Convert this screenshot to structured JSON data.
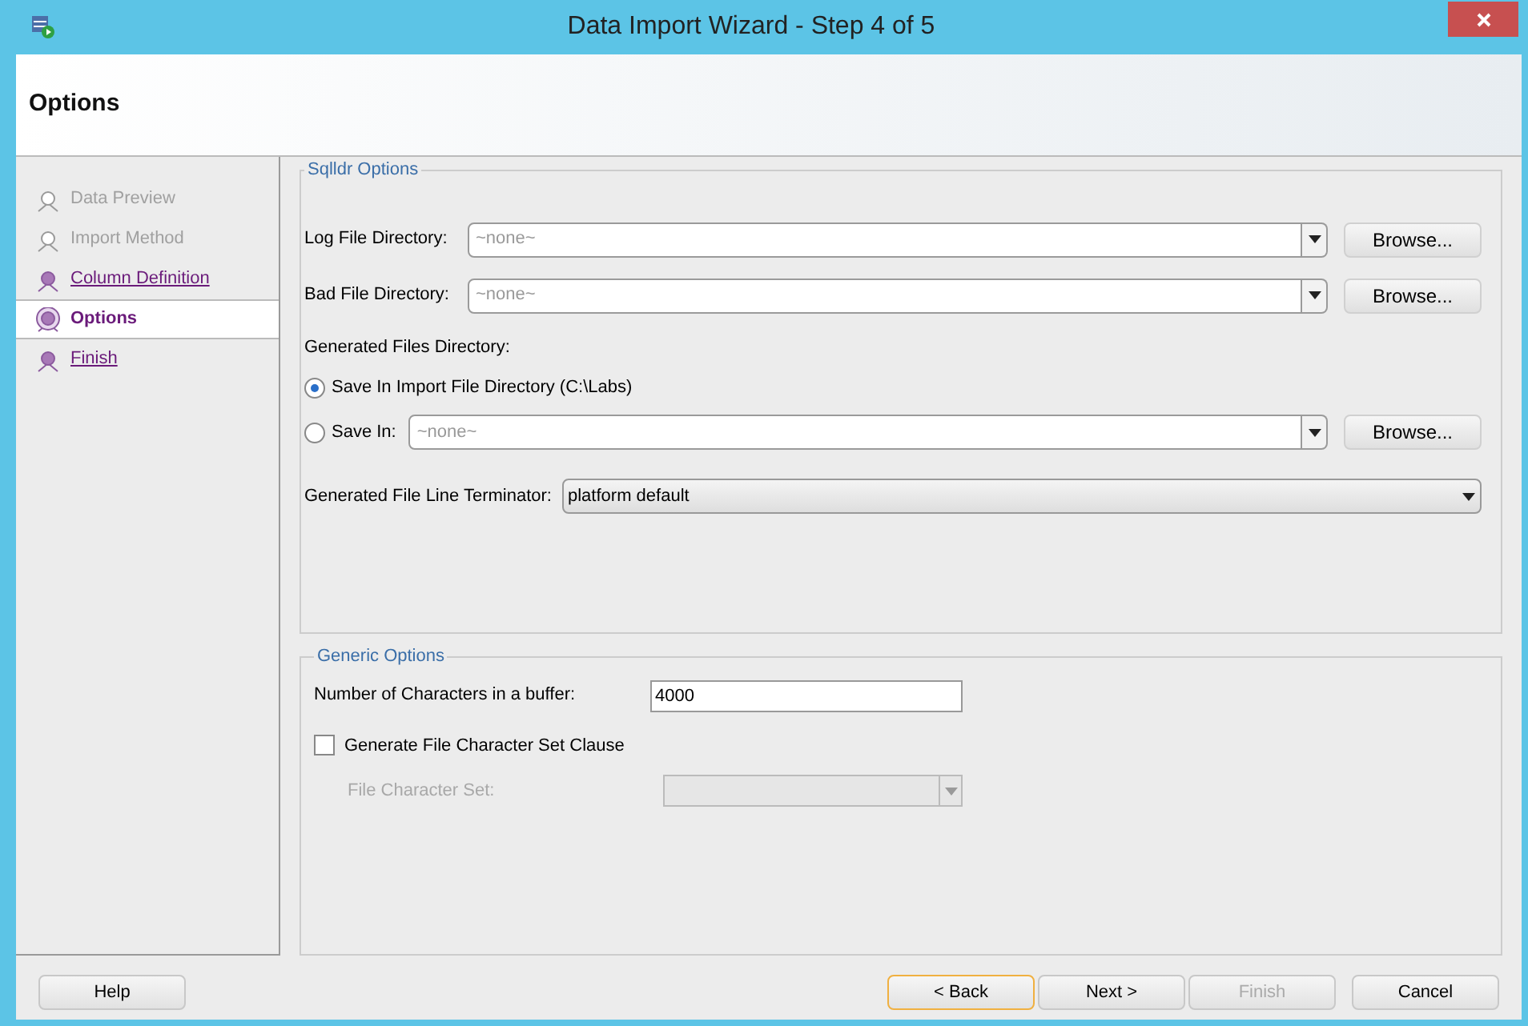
{
  "window": {
    "title": "Data Import Wizard - Step 4 of 5"
  },
  "header": {
    "title": "Options"
  },
  "steps": [
    {
      "label": "Data Preview",
      "enabled": false,
      "selected": false
    },
    {
      "label": "Import Method",
      "enabled": false,
      "selected": false
    },
    {
      "label": "Column Definition",
      "enabled": true,
      "selected": false
    },
    {
      "label": "Options",
      "enabled": true,
      "selected": true
    },
    {
      "label": "Finish",
      "enabled": true,
      "selected": false
    }
  ],
  "sqlldr": {
    "title": "Sqlldr Options",
    "log_dir": {
      "label": "Log File Directory:",
      "placeholder": "~none~",
      "button": "Browse..."
    },
    "bad_dir": {
      "label": "Bad File Directory:",
      "placeholder": "~none~",
      "button": "Browse..."
    },
    "generated_label": "Generated Files Directory:",
    "radios": [
      {
        "label": "Save In Import File Directory (C:\\Labs)",
        "selected": true
      },
      {
        "label": "Save In:",
        "selected": false,
        "placeholder": "~none~",
        "button": "Browse..."
      }
    ],
    "terminator": {
      "label": "Generated File Line Terminator:",
      "value": "platform default"
    }
  },
  "generic": {
    "title": "Generic Options",
    "buffer": {
      "label": "Number of Characters in a buffer:",
      "value": "4000"
    },
    "charset_clause": {
      "label": "Generate File Character Set Clause",
      "checked": false
    },
    "charset": {
      "label": "File Character Set:",
      "disabled": true
    }
  },
  "buttons": [
    {
      "label": "Help",
      "kind": "help",
      "disabled": false,
      "focused": false
    },
    {
      "label": "< Back",
      "kind": "nav",
      "disabled": false,
      "focused": true
    },
    {
      "label": "Next >",
      "kind": "nav",
      "disabled": false,
      "focused": false
    },
    {
      "label": "Finish",
      "kind": "nav",
      "disabled": true,
      "focused": false
    },
    {
      "label": "Cancel",
      "kind": "nav",
      "disabled": false,
      "focused": false
    }
  ]
}
